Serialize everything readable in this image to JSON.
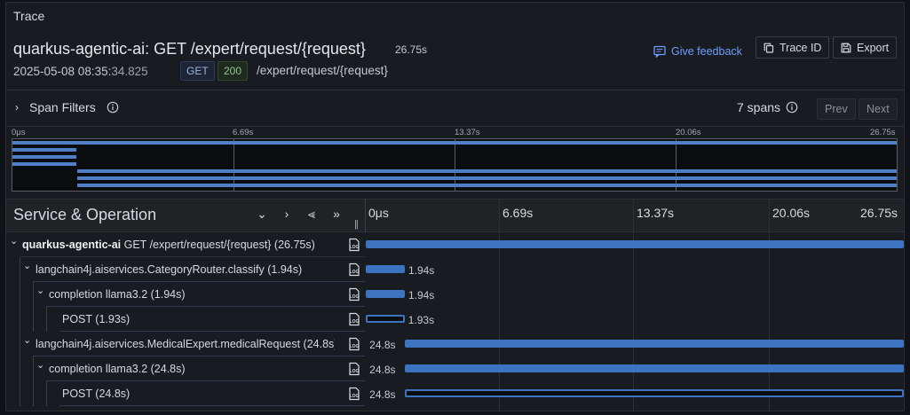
{
  "panel": {
    "title": "Trace"
  },
  "trace": {
    "title": "quarkus-agentic-ai: GET /expert/request/{request}",
    "duration": "26.75s",
    "date": "2025-05-08 08:35:",
    "date_ms": "34.825",
    "method": "GET",
    "status": "200",
    "path": "/expert/request/{request}"
  },
  "actions": {
    "feedback": "Give feedback",
    "trace_id": "Trace ID",
    "export": "Export"
  },
  "filters": {
    "label": "Span Filters",
    "spans_count": "7 spans",
    "prev": "Prev",
    "next": "Next"
  },
  "minimap": {
    "ticks": [
      "0μs",
      "6.69s",
      "13.37s",
      "20.06s",
      "26.75s"
    ]
  },
  "header": {
    "service_operation": "Service & Operation",
    "ticks": [
      "0μs",
      "6.69s",
      "13.37s",
      "20.06s",
      "26.75s"
    ]
  },
  "spans": [
    {
      "service": "quarkus-agentic-ai",
      "operation": "GET /expert/request/{request} (26.75s)",
      "depth": 0,
      "start_s": 0,
      "duration_s": 26.75,
      "label": "",
      "style": "solid"
    },
    {
      "service": "",
      "operation": "langchain4j.aiservices.CategoryRouter.classify (1.94s)",
      "depth": 1,
      "start_s": 0,
      "duration_s": 1.94,
      "label": "1.94s",
      "style": "solid"
    },
    {
      "service": "",
      "operation": "completion llama3.2 (1.94s)",
      "depth": 2,
      "start_s": 0,
      "duration_s": 1.94,
      "label": "1.94s",
      "style": "solid"
    },
    {
      "service": "",
      "operation": "POST (1.93s)",
      "depth": 3,
      "start_s": 0,
      "duration_s": 1.93,
      "label": "1.93s",
      "style": "outline"
    },
    {
      "service": "",
      "operation": "langchain4j.aiservices.MedicalExpert.medicalRequest (24.8s)",
      "depth": 1,
      "start_s": 1.95,
      "duration_s": 24.8,
      "label": "24.8s",
      "style": "solid"
    },
    {
      "service": "",
      "operation": "completion llama3.2 (24.8s)",
      "depth": 2,
      "start_s": 1.95,
      "duration_s": 24.8,
      "label": "24.8s",
      "style": "solid"
    },
    {
      "service": "",
      "operation": "POST (24.8s)",
      "depth": 3,
      "start_s": 1.95,
      "duration_s": 24.8,
      "label": "24.8s",
      "style": "outline"
    }
  ],
  "colors": {
    "span": "#3d74c1",
    "accent_link": "#6e9fff"
  }
}
